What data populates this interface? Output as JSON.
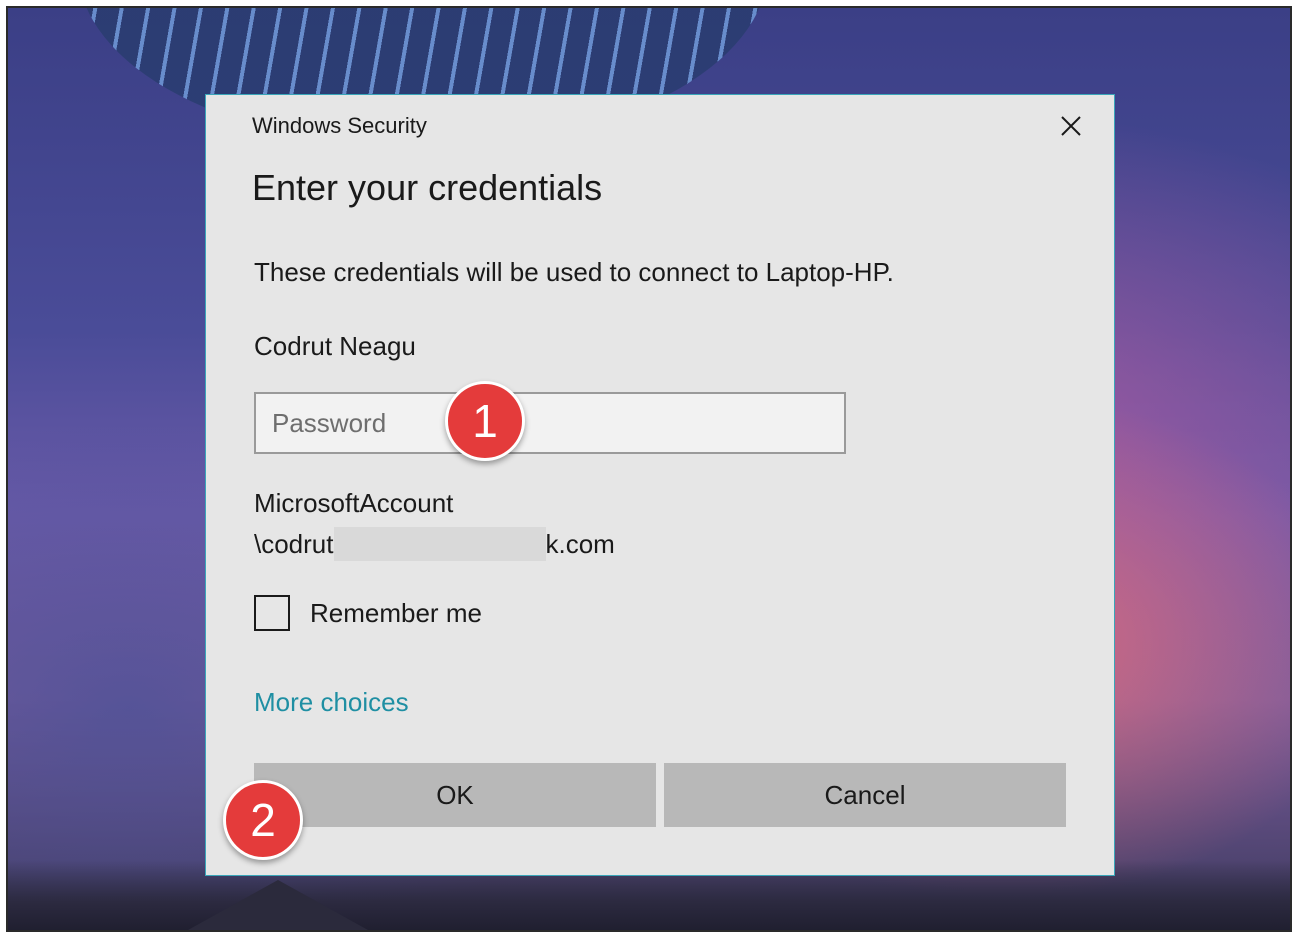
{
  "dialog": {
    "window_title": "Windows Security",
    "close_icon": "close-icon",
    "heading": "Enter your credentials",
    "description": "These credentials will be used to connect to Laptop-HP.",
    "username": "Codrut Neagu",
    "password_placeholder": "Password",
    "password_value": "",
    "account_line1": "MicrosoftAccount",
    "account_line2_prefix": "\\codrut",
    "account_line2_suffix": "k.com",
    "remember_label": "Remember me",
    "remember_checked": false,
    "more_choices": "More choices",
    "ok_label": "OK",
    "cancel_label": "Cancel",
    "accent_color": "#1f8fa3"
  },
  "annotations": {
    "step1": "1",
    "step2": "2",
    "badge_color": "#e43b3b"
  }
}
